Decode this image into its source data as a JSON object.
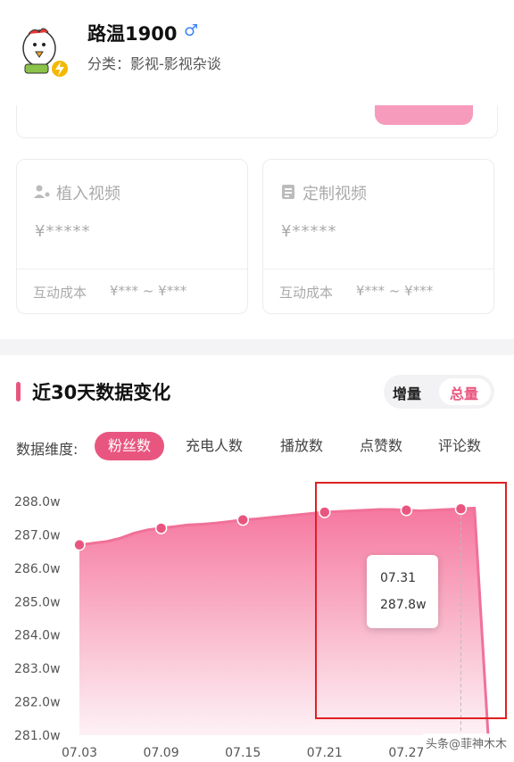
{
  "profile": {
    "name": "路温1900",
    "gender_symbol": "♂",
    "category": "分类：影视-影视杂谈",
    "avatar_icon": "cartoon-chicken-avatar",
    "badge_icon": "lightning-badge-icon"
  },
  "cards": [
    {
      "icon": "placement-icon",
      "title": "植入视频",
      "price": "¥*****",
      "cost_label": "互动成本",
      "cost_range": "¥*** ~ ¥***"
    },
    {
      "icon": "custom-video-icon",
      "title": "定制视频",
      "price": "¥*****",
      "cost_label": "互动成本",
      "cost_range": "¥*** ~ ¥***"
    }
  ],
  "section": {
    "title": "近30天数据变化",
    "toggle": {
      "increment": "增量",
      "total": "总量",
      "selected": "总量"
    }
  },
  "dimensions": {
    "label": "数据维度:",
    "items": [
      "粉丝数",
      "充电人数",
      "播放数",
      "点赞数",
      "评论数"
    ],
    "selected": "粉丝数"
  },
  "chart_data": {
    "type": "area",
    "y_unit": "w",
    "ylim": [
      281.0,
      288.0
    ],
    "yticks": [
      "288.0w",
      "287.0w",
      "286.0w",
      "285.0w",
      "284.0w",
      "283.0w",
      "282.0w",
      "281.0w"
    ],
    "xticks": [
      "07.03",
      "07.09",
      "07.15",
      "07.21",
      "07.27"
    ],
    "series": [
      {
        "values": [
          286.7,
          286.75,
          286.8,
          286.9,
          287.05,
          287.15,
          287.2,
          287.25,
          287.3,
          287.32,
          287.35,
          287.4,
          287.45,
          287.48,
          287.52,
          287.56,
          287.6,
          287.64,
          287.68,
          287.7,
          287.72,
          287.74,
          287.76,
          287.76,
          287.74,
          287.72,
          287.74,
          287.76,
          287.78,
          287.8,
          281.0
        ],
        "markers_at": [
          0,
          6,
          12,
          18,
          24,
          28
        ]
      }
    ],
    "grid": false,
    "tooltip": {
      "date": "07.31",
      "value": "287.8w"
    },
    "colors": {
      "line": "#f07199",
      "marker": "#e8567f",
      "fill_top": "#f5709a",
      "fill_bottom": "#fdf0f4"
    }
  },
  "watermark": "头条@菲神木木",
  "colors": {
    "accent": "#e8567f",
    "highlight_border": "#e02020"
  }
}
